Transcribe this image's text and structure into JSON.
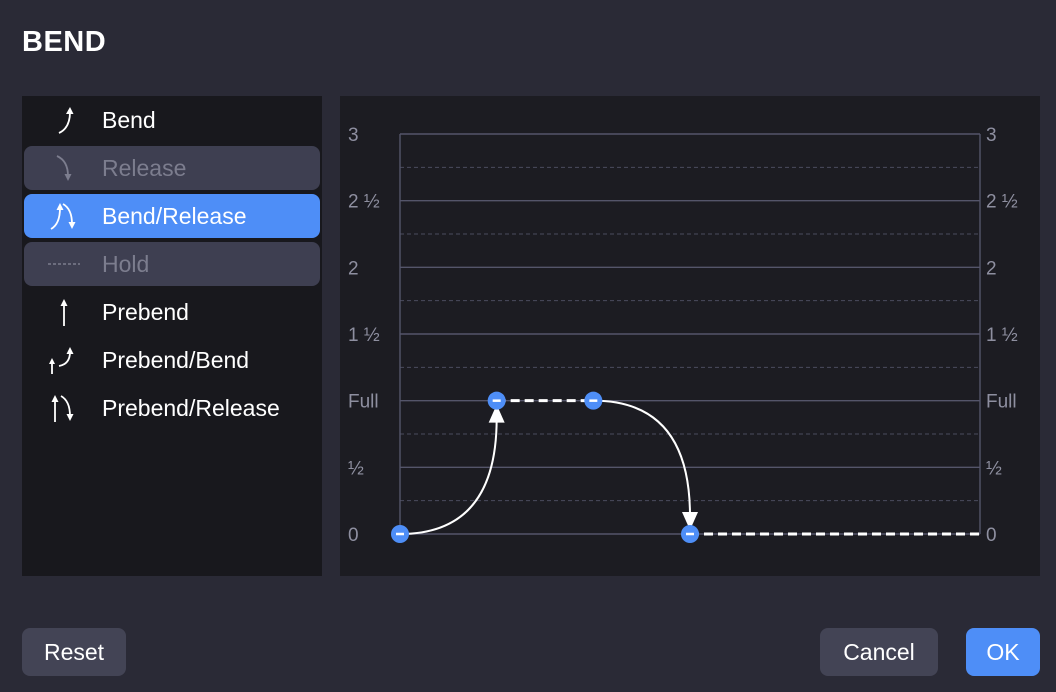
{
  "dialog": {
    "title": "BEND"
  },
  "bend_types": [
    {
      "label": "Bend",
      "icon": "bend-icon",
      "state": "normal"
    },
    {
      "label": "Release",
      "icon": "release-icon",
      "state": "disabled"
    },
    {
      "label": "Bend/Release",
      "icon": "bend-release-icon",
      "state": "selected"
    },
    {
      "label": "Hold",
      "icon": "hold-icon",
      "state": "disabled"
    },
    {
      "label": "Prebend",
      "icon": "prebend-icon",
      "state": "normal"
    },
    {
      "label": "Prebend/Bend",
      "icon": "prebend-bend-icon",
      "state": "normal"
    },
    {
      "label": "Prebend/Release",
      "icon": "prebend-release-icon",
      "state": "normal"
    }
  ],
  "graph": {
    "y_labels": [
      "3",
      "2 ½",
      "2",
      "1 ½",
      "Full",
      "½",
      "0"
    ],
    "points": [
      {
        "t": 0,
        "level": 0
      },
      {
        "t": 1,
        "level": 1
      },
      {
        "t": 2,
        "level": 1
      },
      {
        "t": 3,
        "level": 0
      }
    ],
    "time_max": 6,
    "level_max": 3
  },
  "buttons": {
    "reset": "Reset",
    "cancel": "Cancel",
    "ok": "OK"
  },
  "colors": {
    "accent": "#4e8ef7",
    "background": "#2a2a36",
    "panel": "#18181d",
    "graph_bg": "#1c1c22",
    "disabled": "#3e3f51"
  }
}
